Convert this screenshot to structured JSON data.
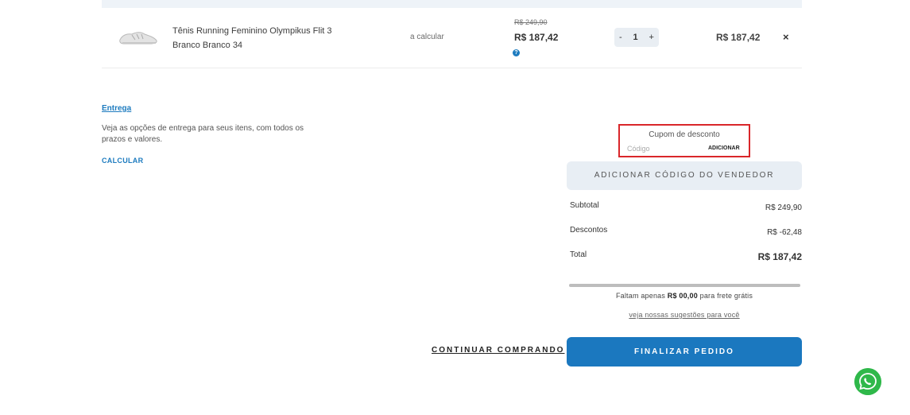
{
  "cart": {
    "item": {
      "image_icon": "sneaker-icon",
      "name": "Tênis Running Feminino Olympikus Flit 3 Branco Branco 34",
      "shipping": "a calcular",
      "price_old": "R$ 249,90",
      "price_new": "R$ 187,42",
      "help_icon": "?",
      "qty_minus": "-",
      "qty": "1",
      "qty_plus": "+",
      "total": "R$ 187,42",
      "remove": "×"
    }
  },
  "delivery": {
    "title": "Entrega",
    "description": "Veja as opções de entrega para seus itens, com todos os prazos e valores.",
    "calculate": "CALCULAR"
  },
  "coupon": {
    "label": "Cupom de desconto",
    "placeholder": "Código",
    "add": "ADICIONAR"
  },
  "seller": {
    "button": "ADICIONAR CÓDIGO DO VENDEDOR"
  },
  "summary": {
    "subtotal_label": "Subtotal",
    "subtotal_value": "R$ 249,90",
    "discount_label": "Descontos",
    "discount_value": "R$ -62,48",
    "total_label": "Total",
    "total_value": "R$ 187,42"
  },
  "free_shipping": {
    "progress": 1,
    "prefix": "Faltam apenas",
    "amount": "R$ 00,00",
    "suffix": "para frete grátis",
    "suggestions": "veja nossas sugestões para você"
  },
  "actions": {
    "continue": "CONTINUAR COMPRANDO",
    "checkout": "FINALIZAR PEDIDO"
  },
  "floating": {
    "whatsapp_icon": "whatsapp-icon"
  }
}
